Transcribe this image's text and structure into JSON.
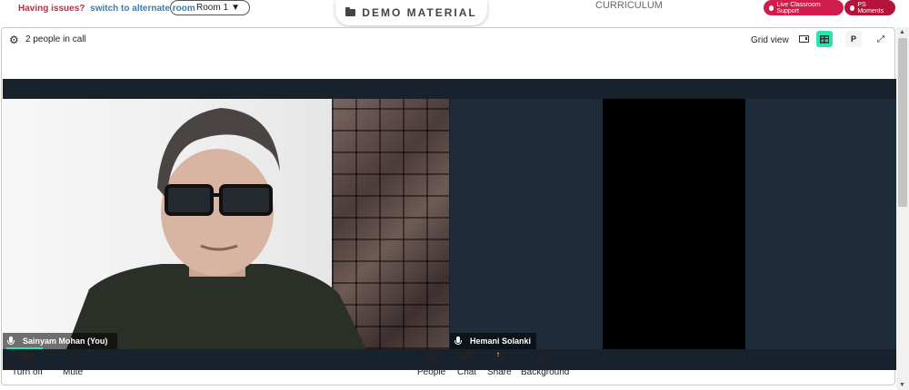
{
  "topbar": {
    "issues_text": "Having issues?",
    "switch_link": "switch to alternate room",
    "room_select_value": "Room 1",
    "demo_material_label": "DEMO MATERIAL",
    "curriculum_label": "CURRICULUM",
    "live_support_label": "Live Classroom Support",
    "ps_moments_label": "PS Moments"
  },
  "call": {
    "people_count_label": "2 people in call",
    "view_label": "Grid view",
    "p_button_label": "P",
    "participants": [
      {
        "name": "Sainyam Mohan (You)"
      },
      {
        "name": "Hemani Solanki"
      }
    ]
  },
  "controls": {
    "camera_label": "Turn off",
    "mic_label": "Mute",
    "people_label": "People",
    "chat_label": "Chat",
    "share_label": "Share",
    "background_label": "Background"
  },
  "colors": {
    "accent": "#2fe0b0",
    "brand_red": "#d01c4d",
    "stage_bg": "#17222d"
  },
  "icons": [
    "folder-icon",
    "gear-icon",
    "sidebar-view-icon",
    "grid-view-icon",
    "expand-icon",
    "mic-icon",
    "camera-icon",
    "person-icon",
    "chat-icon",
    "share-icon",
    "background-icon",
    "chevron-down-icon"
  ]
}
